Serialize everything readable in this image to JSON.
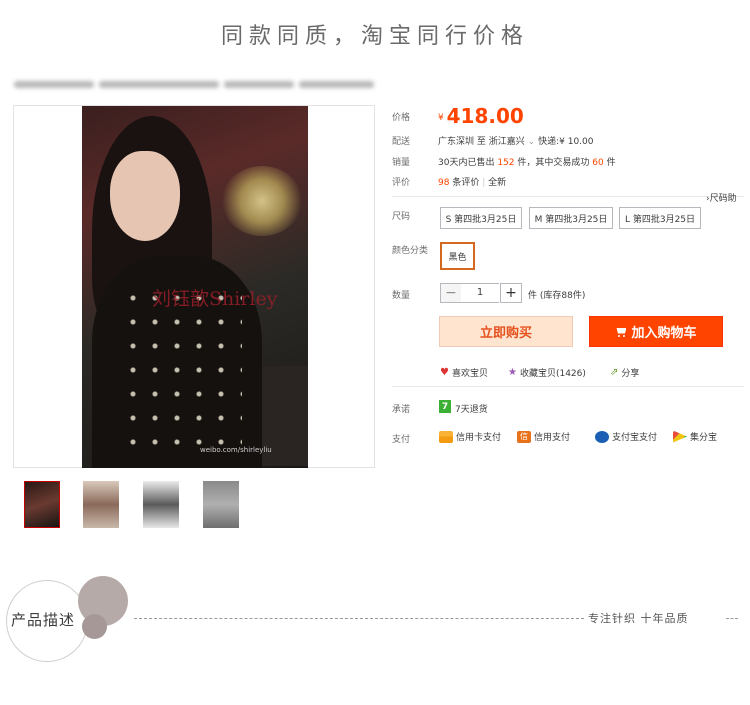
{
  "banner": {
    "title": "同款同质，淘宝同行价格"
  },
  "gallery": {
    "watermark_brand": "刘钰歆Shirley",
    "watermark_weibo": "weibo.com/shirleyliu",
    "thumbnail_count": 4
  },
  "product": {
    "price_label": "价格",
    "currency": "¥",
    "price": "418.00",
    "shipping_label": "配送",
    "ship_from": "广东深圳",
    "ship_to_sep": "至",
    "ship_to": "浙江嘉兴",
    "ship_fee": "快递:¥ 10.00",
    "sales_label": "销量",
    "sales_prefix": "30天内已售出",
    "sales_count": "152",
    "sales_mid": "件，其中交易成功",
    "sales_success": "60",
    "sales_suffix": "件",
    "rating_label": "评价",
    "rating_count": "98",
    "rating_suffix": "条评价",
    "condition": "全新",
    "size_label": "尺码",
    "size_guide": "尺码助",
    "sizes": [
      "S 第四批3月25日",
      "M 第四批3月25日",
      "L 第四批3月25日"
    ],
    "color_label": "颜色分类",
    "colors": [
      "黑色"
    ],
    "qty_label": "数量",
    "qty_value": "1",
    "qty_unit": "件",
    "stock": "(库存88件)",
    "buy_now": "立即购买",
    "add_cart": "加入购物车"
  },
  "social": {
    "like": "喜欢宝贝",
    "favorite": "收藏宝贝(1426)",
    "share": "分享"
  },
  "service": {
    "promise_label": "承诺",
    "promise_badge": "7",
    "promise_text": "7天退货",
    "pay_label": "支付",
    "pay_methods": [
      "信用卡支付",
      "信用支付",
      "支付宝支付",
      "集分宝"
    ],
    "xin_glyph": "信"
  },
  "description": {
    "title": "产品描述",
    "slogan": "专注针织 十年品质"
  },
  "colors_meta": {
    "accent": "#ff4400",
    "buy_bg": "#ffe4d0",
    "selected_border": "#d2691e"
  }
}
